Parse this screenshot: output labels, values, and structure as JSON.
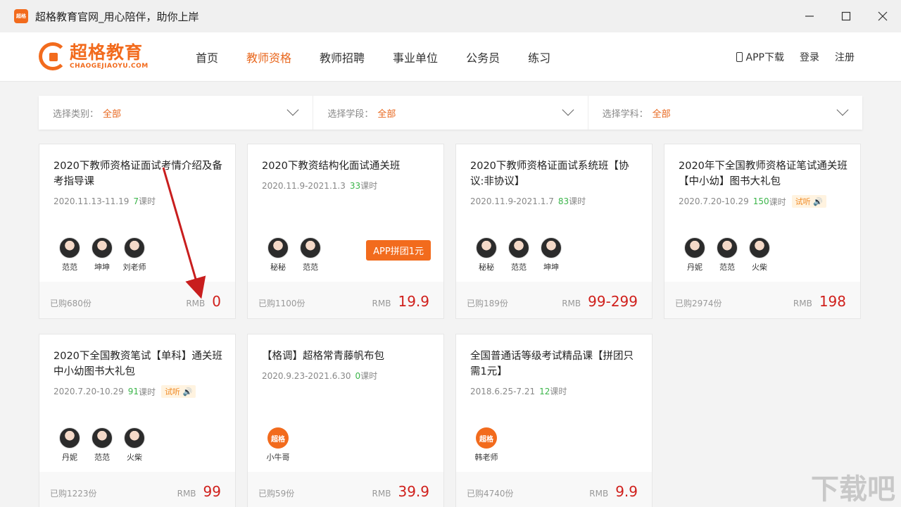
{
  "window": {
    "icon_text": "超格",
    "title": "超格教育官网_用心陪伴，助你上岸"
  },
  "logo": {
    "cn": "超格教育",
    "en": "CHAOGEJIAOYU.COM"
  },
  "nav": {
    "items": [
      "首页",
      "教师资格",
      "教师招聘",
      "事业单位",
      "公务员",
      "练习"
    ],
    "active_index": 1,
    "app_download": "APP下载",
    "login": "登录",
    "register": "注册"
  },
  "filters": [
    {
      "label": "选择类别：",
      "value": "全部"
    },
    {
      "label": "选择学段：",
      "value": "全部"
    },
    {
      "label": "选择学科：",
      "value": "全部"
    }
  ],
  "courses": [
    {
      "title": "2020下教师资格证面试考情介绍及备考指导课",
      "date": "2020.11.13-11.19",
      "lessons": "7",
      "lessons_unit": "课时",
      "trial": "",
      "teachers": [
        "范范",
        "坤坤",
        "刘老师"
      ],
      "sold": "已购680份",
      "rmb": "RMB",
      "price": "0",
      "promo": ""
    },
    {
      "title": "2020下教资结构化面试通关班",
      "date": "2020.11.9-2021.1.3",
      "lessons": "33",
      "lessons_unit": "课时",
      "trial": "",
      "teachers": [
        "秘秘",
        "范范"
      ],
      "sold": "已购1100份",
      "rmb": "RMB",
      "price": "19.9",
      "promo": "APP拼团1元"
    },
    {
      "title": "2020下教师资格证面试系统班【协议:非协议】",
      "date": "2020.11.9-2021.1.7",
      "lessons": "83",
      "lessons_unit": "课时",
      "trial": "",
      "teachers": [
        "秘秘",
        "范范",
        "坤坤"
      ],
      "sold": "已购189份",
      "rmb": "RMB",
      "price": "99-299",
      "promo": ""
    },
    {
      "title": "2020年下全国教师资格证笔试通关班【中小幼】图书大礼包",
      "date": "2020.7.20-10.29",
      "lessons": "150",
      "lessons_unit": "课时",
      "trial": "试听",
      "teachers": [
        "丹妮",
        "范范",
        "火柴"
      ],
      "sold": "已购2974份",
      "rmb": "RMB",
      "price": "198",
      "promo": ""
    },
    {
      "title": "2020下全国教资笔试【单科】通关班中小幼图书大礼包",
      "date": "2020.7.20-10.29",
      "lessons": "91",
      "lessons_unit": "课时",
      "trial": "试听",
      "teachers": [
        "丹妮",
        "范范",
        "火柴"
      ],
      "sold": "已购1223份",
      "rmb": "RMB",
      "price": "99",
      "promo": ""
    },
    {
      "title": "【格调】超格常青藤帆布包",
      "date": "2020.9.23-2021.6.30",
      "lessons": "0",
      "lessons_unit": "课时",
      "trial": "",
      "teachers": [
        "小牛哥"
      ],
      "sold": "已购59份",
      "rmb": "RMB",
      "price": "39.9",
      "promo": ""
    },
    {
      "title": "全国普通话等级考试精品课【拼团只需1元】",
      "date": "2018.6.25-7.21",
      "lessons": "12",
      "lessons_unit": "课时",
      "trial": "",
      "teachers": [
        "韩老师"
      ],
      "sold": "已购4740份",
      "rmb": "RMB",
      "price": "9.9",
      "promo": ""
    }
  ],
  "watermark": "下载吧"
}
